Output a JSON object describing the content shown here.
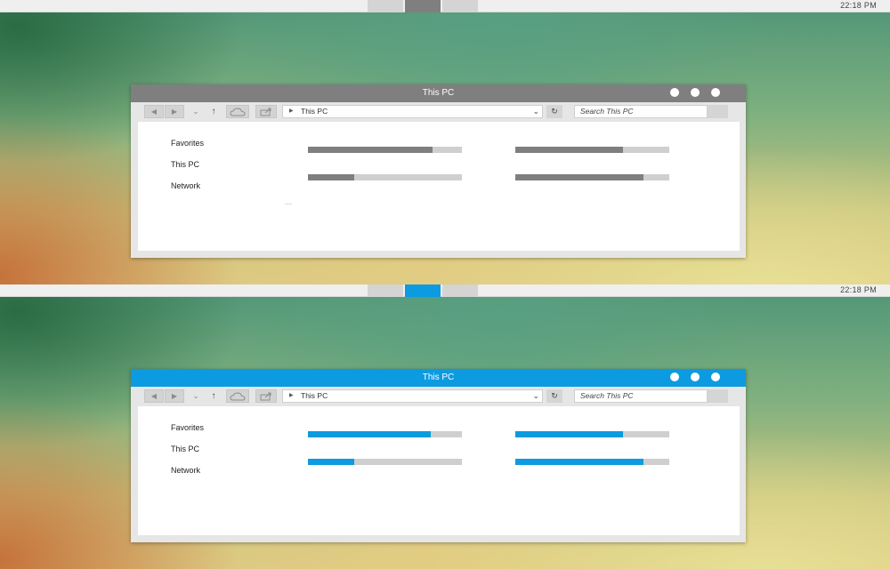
{
  "screens": [
    {
      "theme": "gray",
      "accent_color": "#7f7f7f",
      "clock": "22:18 PM",
      "window": {
        "title": "This PC",
        "address": "This PC",
        "search_placeholder": "Search This PC",
        "nav_items": [
          "Favorites",
          "This PC",
          "Network"
        ],
        "drive_usage_fractions": [
          0.81,
          0.7,
          0.3,
          0.83
        ]
      }
    },
    {
      "theme": "blue",
      "accent_color": "#0c9be0",
      "clock": "22:18 PM",
      "window": {
        "title": "This PC",
        "address": "This PC",
        "search_placeholder": "Search This PC",
        "nav_items": [
          "Favorites",
          "This PC",
          "Network"
        ],
        "drive_usage_fractions": [
          0.8,
          0.7,
          0.3,
          0.83
        ]
      }
    }
  ],
  "icons": {
    "back": "back-arrow-icon",
    "forward": "forward-arrow-icon",
    "recent": "recent-dropdown-icon",
    "up": "up-arrow-icon",
    "cloud": "cloud-icon",
    "share": "share-icon",
    "address_caret": "breadcrumb-caret-icon",
    "address_dropdown": "chevron-down-icon",
    "refresh": "refresh-icon"
  }
}
